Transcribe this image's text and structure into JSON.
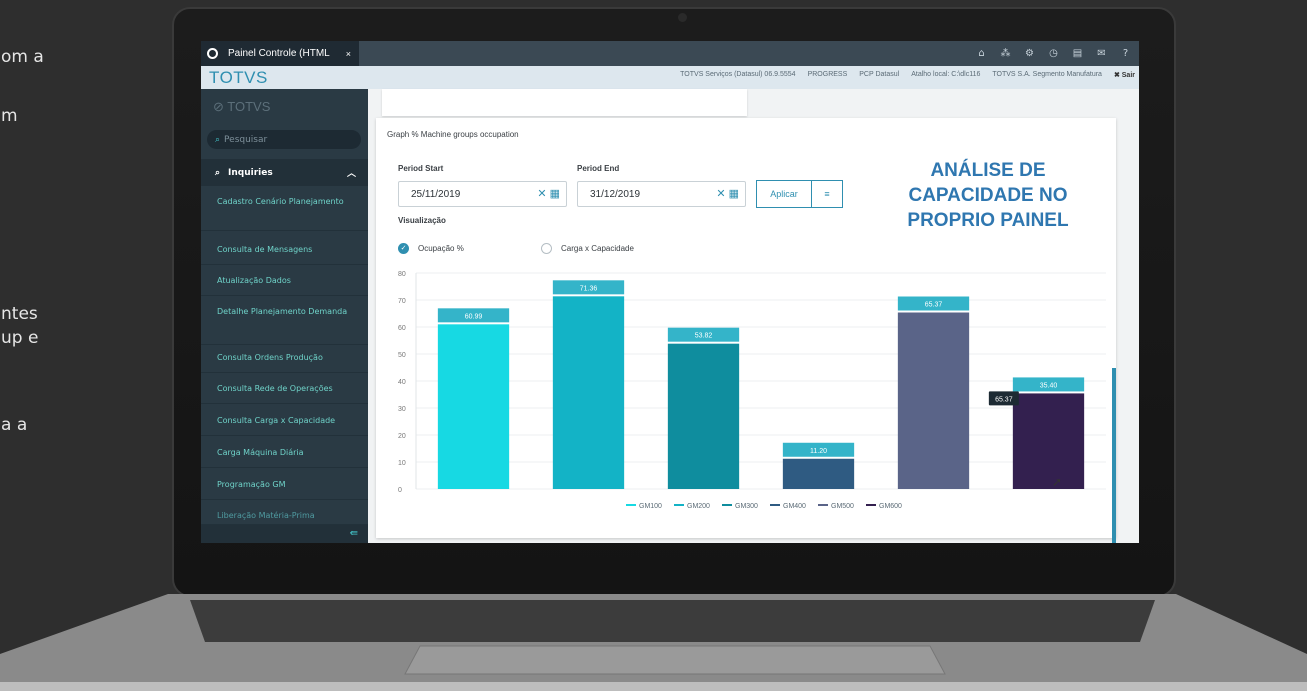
{
  "background_text": [
    "om a",
    "m",
    "ntes",
    "up e",
    "a a"
  ],
  "tab": {
    "title": "Painel Controle (HTML",
    "close": "×"
  },
  "top_icons": [
    "home-icon",
    "network-icon",
    "gear-icon",
    "clock-icon",
    "document-icon",
    "mail-icon",
    "help-icon"
  ],
  "header": {
    "brand": "TOTVS",
    "info": [
      "TOTVS Serviços (Datasul) 06.9.5554",
      "PROGRESS",
      "PCP Datasul",
      "Atalho local: C:\\dlc116",
      "TOTVS S.A. Segmento Manufatura"
    ],
    "exit": "✖ Sair"
  },
  "sidebar": {
    "logo": "⊘ TOTVS",
    "search_placeholder": "Pesquisar",
    "section": "Inquiries",
    "items": [
      "Cadastro Cenário Planejamento",
      "Consulta de Mensagens",
      "Atualização Dados",
      "Detalhe Planejamento Demanda",
      "Consulta Ordens Produção",
      "Consulta Rede de Operações",
      "Consulta Carga x Capacidade",
      "Carga Máquina Diária",
      "Programação GM",
      "Liberação Matéria-Prima"
    ]
  },
  "card": {
    "title": "Graph % Machine groups occupation",
    "period_start_label": "Period Start",
    "period_start": "25/11/2019",
    "period_end_label": "Period End",
    "period_end": "31/12/2019",
    "apply": "Aplicar",
    "visualization_label": "Visualização",
    "option_occupation": "Ocupação %",
    "option_load": "Carga x Capacidade",
    "headline": "ANÁLISE DE CAPACIDADE NO PROPRIO PAINEL"
  },
  "colors": {
    "accent": "#2f8fb0",
    "sidebar": "#2a3a44",
    "headline": "#2f77b0"
  },
  "chart_data": {
    "type": "bar",
    "categories": [
      "GM100",
      "GM200",
      "GM300",
      "GM400",
      "GM500",
      "GM600"
    ],
    "values": [
      60.99,
      71.36,
      53.82,
      11.2,
      65.37,
      35.4
    ],
    "labels": [
      "60.99",
      "71.36",
      "53.82",
      "11.20",
      "65.37",
      "35.40"
    ],
    "series_names": [
      "GM100",
      "GM200",
      "GM300",
      "GM400",
      "GM500",
      "GM600"
    ],
    "colors": [
      "#17d9e3",
      "#13b3c6",
      "#0f8d9e",
      "#2f5b82",
      "#5a6488",
      "#33204f"
    ],
    "ylim": [
      0,
      80
    ],
    "yticks": [
      "0",
      "10",
      "20",
      "30",
      "40",
      "50",
      "60",
      "70",
      "80"
    ],
    "tooltip": "65.37",
    "legend": "bottom",
    "grid": true
  }
}
